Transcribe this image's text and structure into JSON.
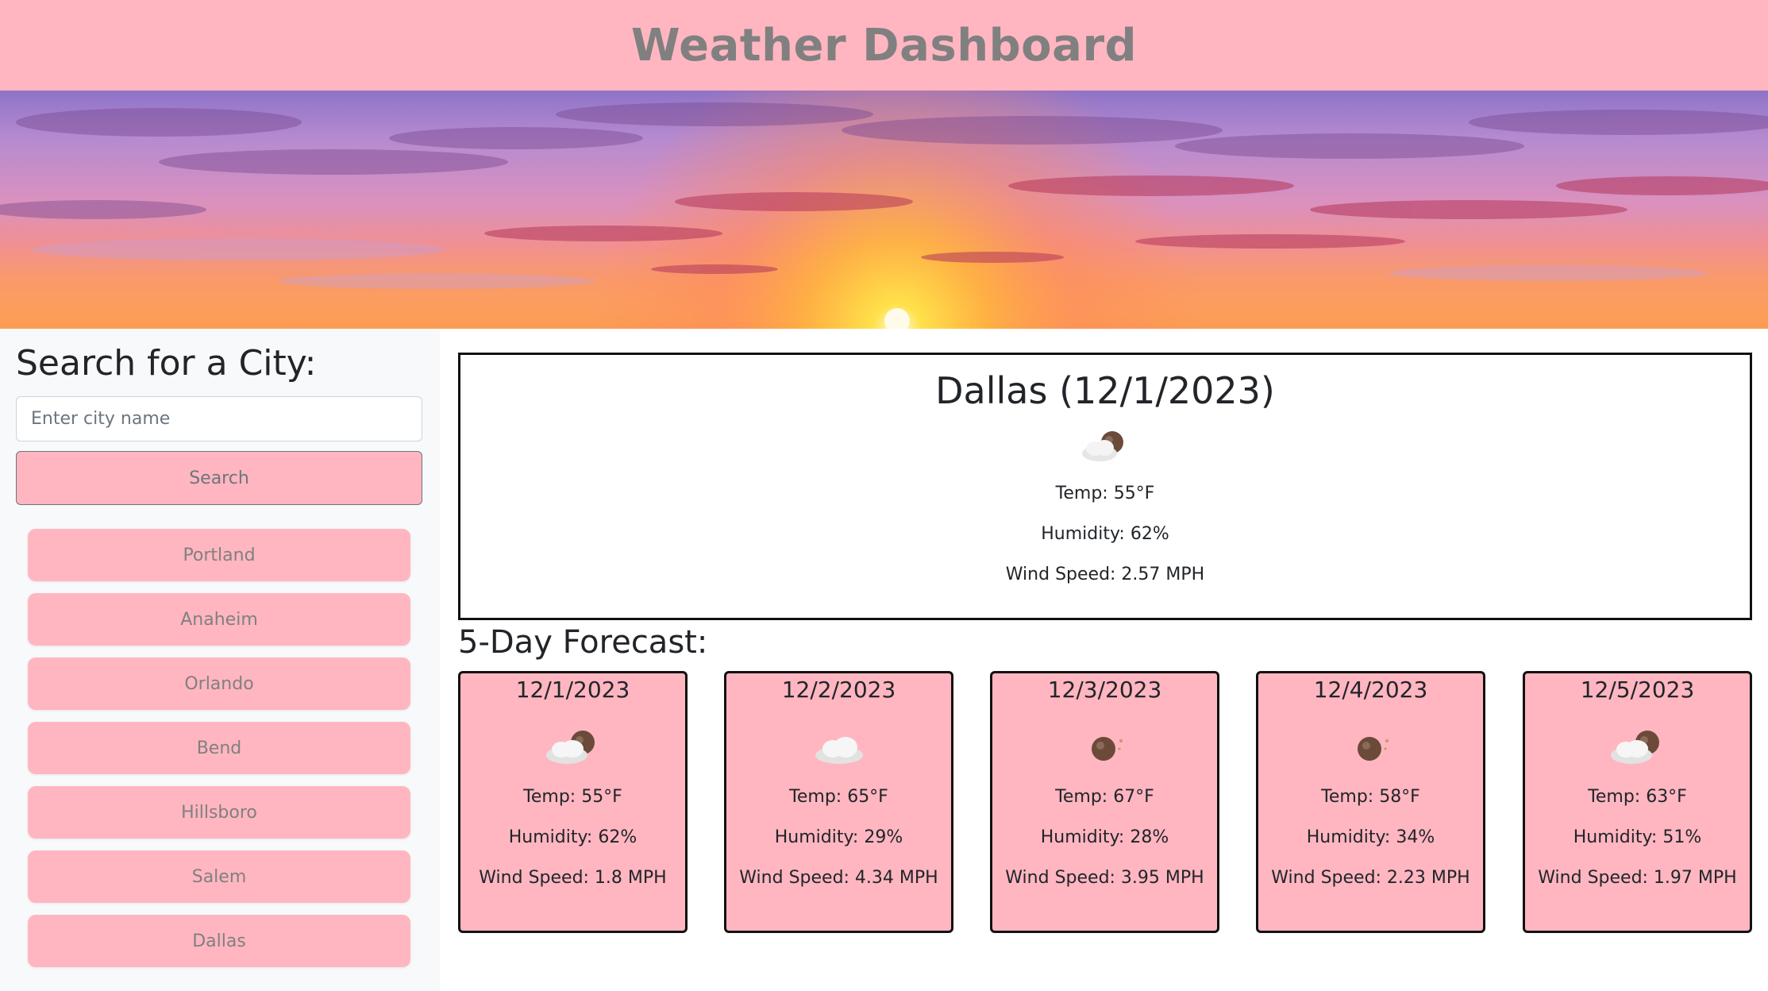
{
  "header": {
    "title": "Weather Dashboard"
  },
  "hero": {
    "image": "sunset-sky-banner"
  },
  "sidebar": {
    "heading": "Search for a City:",
    "input": {
      "placeholder": "Enter city name",
      "value": ""
    },
    "search_label": "Search",
    "history": [
      {
        "label": "Portland"
      },
      {
        "label": "Anaheim"
      },
      {
        "label": "Orlando"
      },
      {
        "label": "Bend"
      },
      {
        "label": "Hillsboro"
      },
      {
        "label": "Salem"
      },
      {
        "label": "Dallas"
      }
    ]
  },
  "current": {
    "title": "Dallas (12/1/2023)",
    "icon": "partly-cloudy-night-icon",
    "temp": "Temp: 55°F",
    "humidity": "Humidity: 62%",
    "wind": "Wind Speed: 2.57 MPH"
  },
  "forecast": {
    "heading": "5-Day Forecast:",
    "days": [
      {
        "date": "12/1/2023",
        "icon": "partly-cloudy-night-icon",
        "temp": "Temp: 55°F",
        "humidity": "Humidity: 62%",
        "wind": "Wind Speed: 1.8 MPH"
      },
      {
        "date": "12/2/2023",
        "icon": "cloud-icon",
        "temp": "Temp: 65°F",
        "humidity": "Humidity: 29%",
        "wind": "Wind Speed: 4.34 MPH"
      },
      {
        "date": "12/3/2023",
        "icon": "clear-night-icon",
        "temp": "Temp: 67°F",
        "humidity": "Humidity: 28%",
        "wind": "Wind Speed: 3.95 MPH"
      },
      {
        "date": "12/4/2023",
        "icon": "clear-night-icon",
        "temp": "Temp: 58°F",
        "humidity": "Humidity: 34%",
        "wind": "Wind Speed: 2.23 MPH"
      },
      {
        "date": "12/5/2023",
        "icon": "partly-cloudy-night-icon",
        "temp": "Temp: 63°F",
        "humidity": "Humidity: 51%",
        "wind": "Wind Speed: 1.97 MPH"
      }
    ]
  },
  "colors": {
    "accent": "#ffb6c1",
    "border": "#111111",
    "muted_text": "#808080"
  }
}
